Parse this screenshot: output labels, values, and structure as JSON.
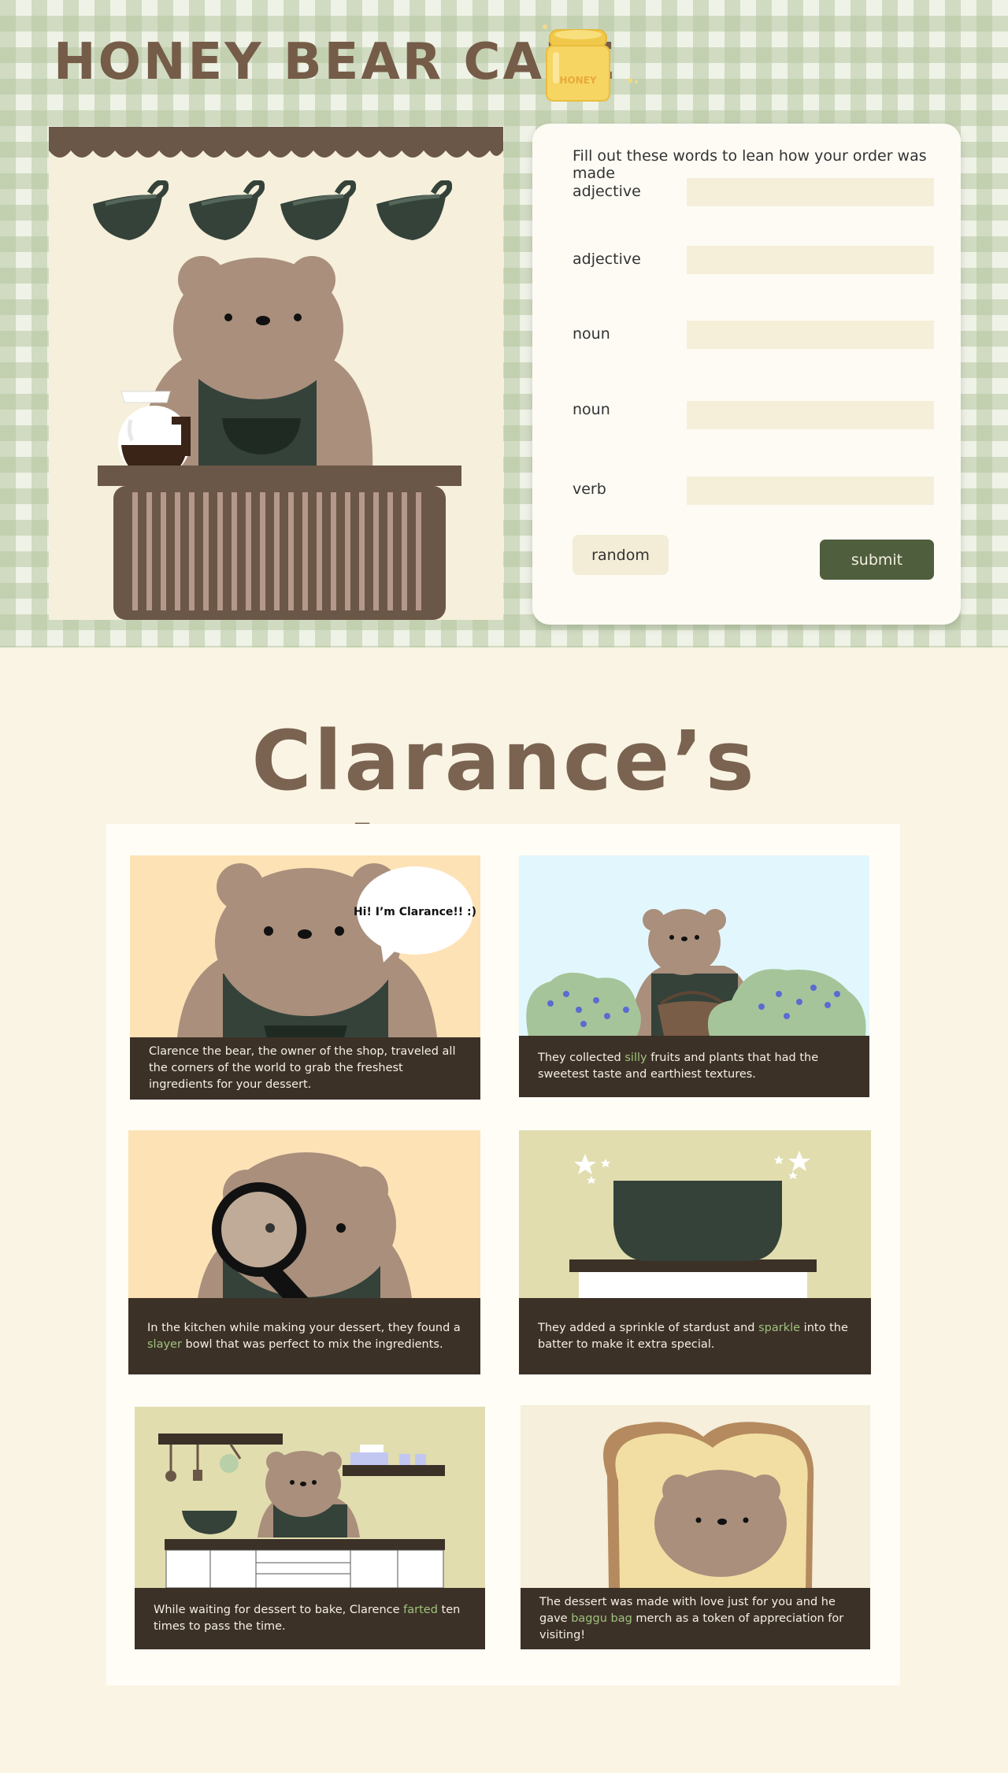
{
  "header": {
    "brand_title": "HONEY BEAR CAFE",
    "honey_jar_label": "HONEY"
  },
  "form": {
    "intro": "Fill out these words to lean how your order was made",
    "fields": [
      {
        "label": "adjective",
        "value": "",
        "placeholder": ""
      },
      {
        "label": "adjective",
        "value": "",
        "placeholder": ""
      },
      {
        "label": "noun",
        "value": "",
        "placeholder": ""
      },
      {
        "label": "noun",
        "value": "",
        "placeholder": ""
      },
      {
        "label": "verb",
        "value": "",
        "placeholder": ""
      }
    ],
    "random_label": "random",
    "submit_label": "submit"
  },
  "story": {
    "title": "Clarance’s Adventure",
    "speech_bubble": "Hi! I’m Clarance!! :)",
    "panels": [
      {
        "pre": "Clarence the bear, the owner of the shop, traveled all the corners of the world to grab the freshest ingredients for your dessert.",
        "word": "",
        "post": ""
      },
      {
        "pre": "They collected ",
        "word": "silly",
        "post": " fruits and plants that had the sweetest taste and earthiest textures."
      },
      {
        "pre": "In the kitchen while making your dessert, they found a ",
        "word": "slayer",
        "post": " bowl that was perfect to mix the ingredients."
      },
      {
        "pre": "They added a sprinkle of stardust and ",
        "word": "sparkle",
        "post": " into the batter to make it extra special."
      },
      {
        "pre": "While waiting for dessert to bake, Clarence ",
        "word": "farted",
        "post": " ten times to pass the time."
      },
      {
        "pre": "The dessert was made with love just for you and he gave ",
        "word": "baggu bag",
        "post": " merch as a token of appreciation for visiting!"
      }
    ]
  },
  "colors": {
    "brown_title": "#755c48",
    "bear_fur": "#a98f7c",
    "apron_green": "#34423a",
    "caption_bg": "#3c3127",
    "highlight_green": "#9fc27d",
    "submit_green": "#4f5e3d"
  }
}
